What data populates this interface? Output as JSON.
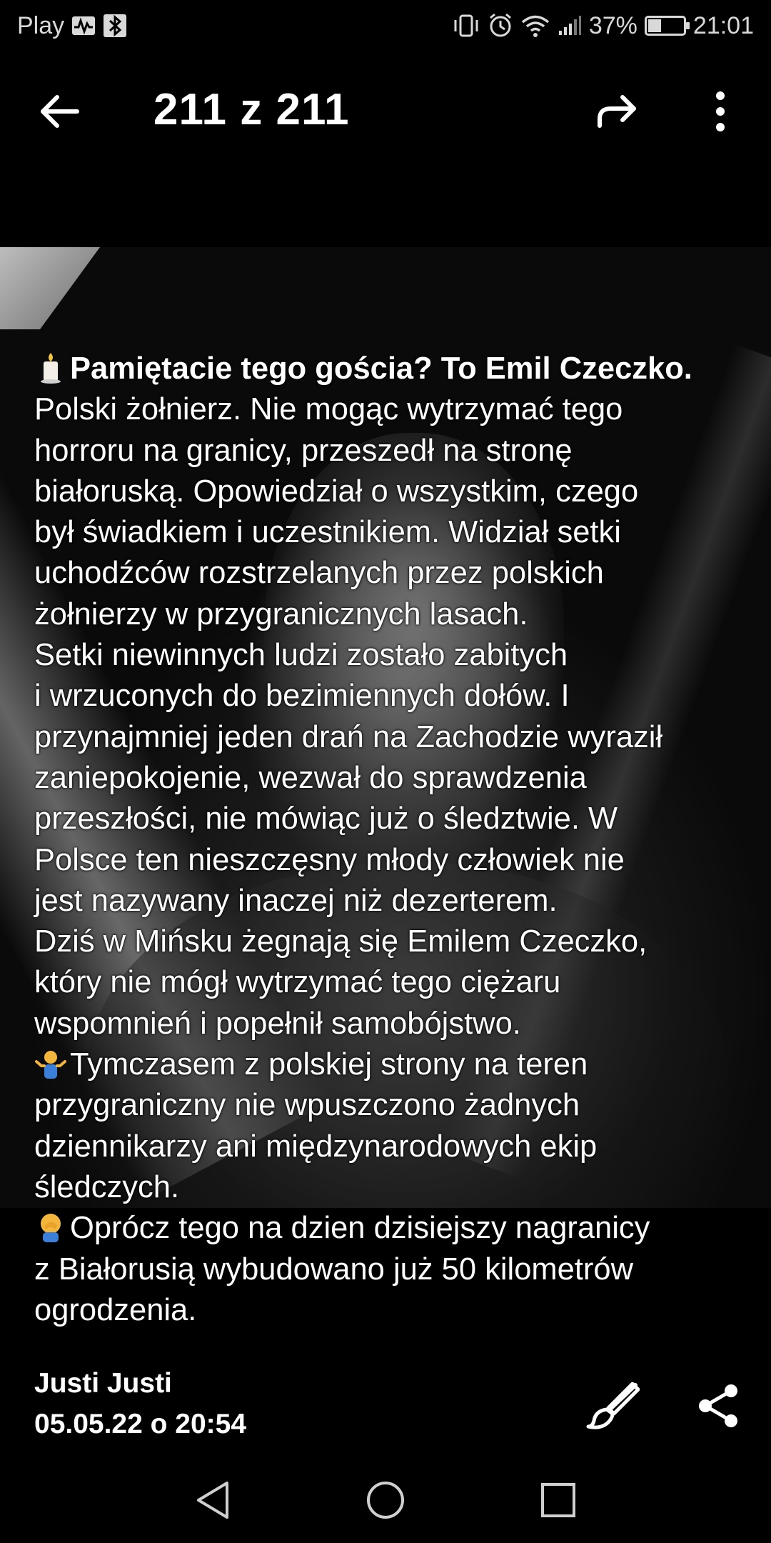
{
  "status_bar": {
    "carrier": "Play",
    "battery": "37%",
    "battery_level": 0.37,
    "time": "21:01",
    "icons": [
      "activity-icon",
      "bluetooth-icon",
      "vibrate-icon",
      "alarm-icon",
      "wifi-icon",
      "signal-icon",
      "battery-icon"
    ]
  },
  "app_bar": {
    "title": "211 z 211",
    "icons": [
      "back-arrow-icon",
      "forward-share-icon",
      "more-vert-icon"
    ]
  },
  "post": {
    "lines": [
      "Pamiętacie tego gościa? To Emil Czeczko.",
      "Polski żołnierz. Nie mogąc wytrzymać tego",
      "horroru na granicy, przeszedł na stronę",
      "białoruską. Opowiedział o wszystkim, czego",
      "był świadkiem i uczestnikiem. Widział setki",
      "uchodźców rozstrzelanych przez polskich",
      "żołnierzy w przygranicznych lasach.",
      "Setki niewinnych ludzi zostało zabitych",
      "i wrzuconych do bezimiennych dołów. I",
      "przynajmniej jeden drań na Zachodzie wyraził",
      "zaniepokojenie, wezwał do sprawdzenia",
      "przeszłości, nie mówiąc już o śledztwie. W",
      "Polsce ten nieszczęsny młody człowiek nie",
      "jest nazywany inaczej niż dezerterem.",
      "Dziś  w Mińsku żegnają się Emilem Czeczko,",
      "który nie mógł wytrzymać tego ciężaru",
      "wspomnień i popełnił samobójstwo.",
      "Tymczasem z polskiej strony na teren",
      "przygraniczny nie wpuszczono żadnych",
      "dziennikarzy ani międzynarodowych ekip",
      "śledczych.",
      "Oprócz tego na dzien dzisiejszy nagranicy",
      "z Białorusią wybudowano już 50 kilometrów",
      "ogrodzenia."
    ],
    "emoji_names": [
      "candle-emoji-icon",
      "person-shrugging-emoji-icon",
      "face-palm-emoji-icon"
    ]
  },
  "footer": {
    "author": "Justi Justi",
    "date": "05.05.22 o 20:54",
    "icons": [
      "brush-icon",
      "share-icon"
    ]
  },
  "nav": {
    "icons": [
      "nav-back-icon",
      "nav-home-icon",
      "nav-recents-icon"
    ]
  }
}
